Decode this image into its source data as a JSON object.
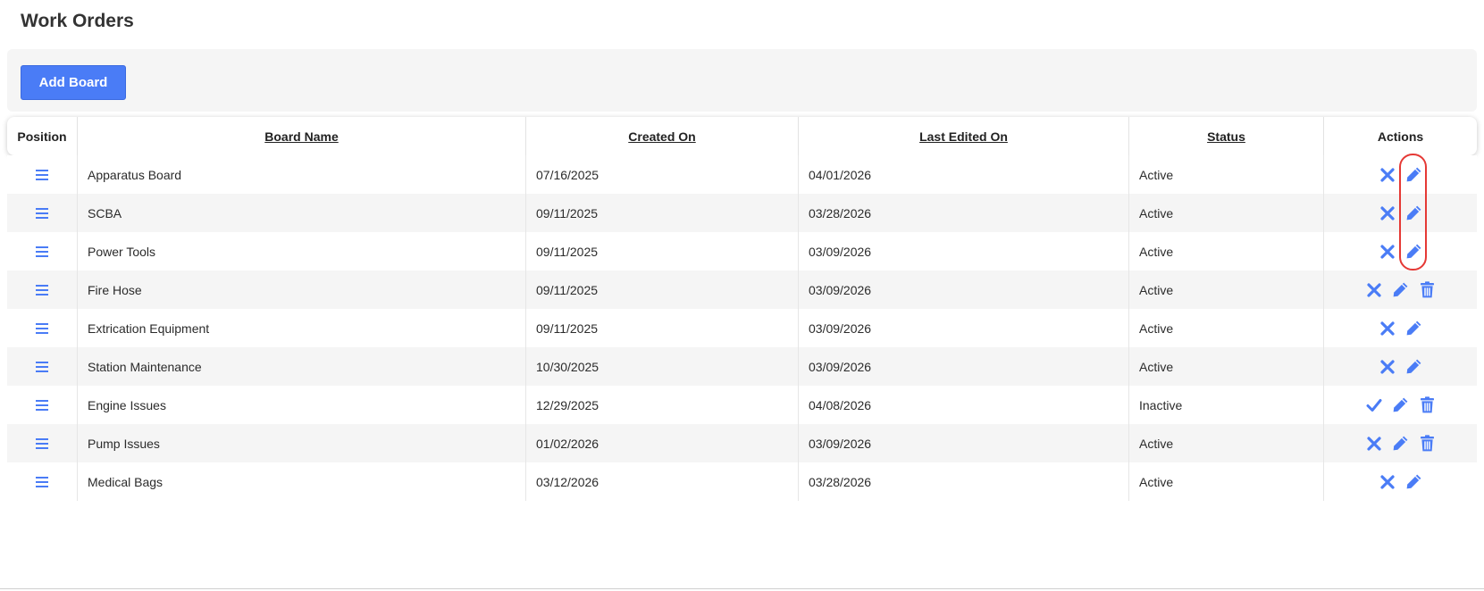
{
  "page": {
    "title": "Work Orders"
  },
  "toolbar": {
    "add_label": "Add Board"
  },
  "table": {
    "headers": {
      "position": "Position",
      "board_name": "Board Name",
      "created_on": "Created On",
      "last_edited_on": "Last Edited On",
      "status": "Status",
      "actions": "Actions"
    },
    "rows": [
      {
        "name": "Apparatus Board",
        "created": "07/16/2025",
        "edited": "04/01/2026",
        "status": "Active",
        "toggle_icon": "x-icon",
        "has_delete": false
      },
      {
        "name": "SCBA",
        "created": "09/11/2025",
        "edited": "03/28/2026",
        "status": "Active",
        "toggle_icon": "x-icon",
        "has_delete": false
      },
      {
        "name": "Power Tools",
        "created": "09/11/2025",
        "edited": "03/09/2026",
        "status": "Active",
        "toggle_icon": "x-icon",
        "has_delete": false
      },
      {
        "name": "Fire Hose",
        "created": "09/11/2025",
        "edited": "03/09/2026",
        "status": "Active",
        "toggle_icon": "x-icon",
        "has_delete": true
      },
      {
        "name": "Extrication Equipment",
        "created": "09/11/2025",
        "edited": "03/09/2026",
        "status": "Active",
        "toggle_icon": "x-icon",
        "has_delete": false
      },
      {
        "name": "Station Maintenance",
        "created": "10/30/2025",
        "edited": "03/09/2026",
        "status": "Active",
        "toggle_icon": "x-icon",
        "has_delete": false
      },
      {
        "name": "Engine Issues",
        "created": "12/29/2025",
        "edited": "04/08/2026",
        "status": "Inactive",
        "toggle_icon": "check-icon",
        "has_delete": true
      },
      {
        "name": "Pump Issues",
        "created": "01/02/2026",
        "edited": "03/09/2026",
        "status": "Active",
        "toggle_icon": "x-icon",
        "has_delete": true
      },
      {
        "name": "Medical Bags",
        "created": "03/12/2026",
        "edited": "03/28/2026",
        "status": "Active",
        "toggle_icon": "x-icon",
        "has_delete": false
      }
    ]
  },
  "colors": {
    "accent": "#4a7cf6",
    "highlight": "#e53935",
    "row_alt": "#f5f5f5"
  }
}
